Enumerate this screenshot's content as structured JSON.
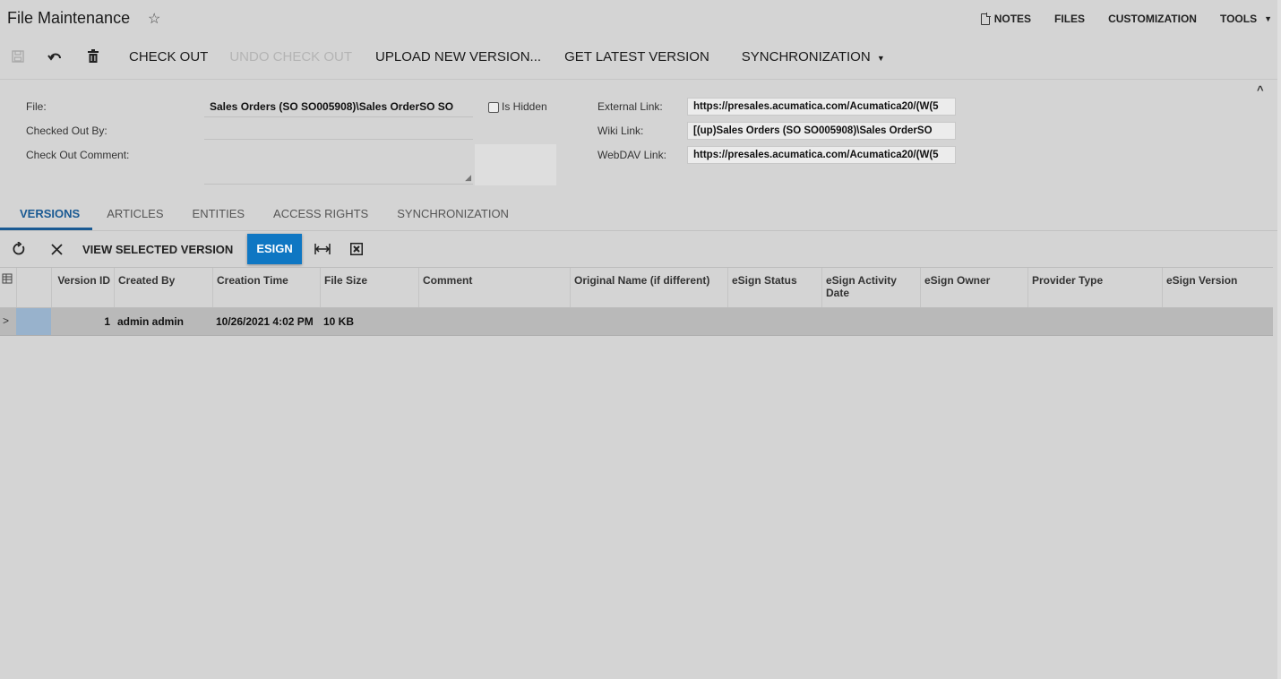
{
  "header": {
    "title": "File Maintenance",
    "star": "☆",
    "links": {
      "notes": "NOTES",
      "files": "FILES",
      "customization": "CUSTOMIZATION",
      "tools": "TOOLS"
    }
  },
  "toolbar": {
    "check_out": "CHECK OUT",
    "undo_check_out": "UNDO CHECK OUT",
    "upload_new_version": "UPLOAD NEW VERSION...",
    "get_latest_version": "GET LATEST VERSION",
    "synchronization": "SYNCHRONIZATION"
  },
  "form": {
    "file_label": "File:",
    "file_value": "Sales Orders (SO SO005908)\\Sales OrderSO SO",
    "is_hidden_label": "Is Hidden",
    "checked_out_by_label": "Checked Out By:",
    "check_out_comment_label": "Check Out Comment:",
    "external_link_label": "External Link:",
    "external_link_value": "https://presales.acumatica.com/Acumatica20/(W(5",
    "wiki_link_label": "Wiki Link:",
    "wiki_link_value": "[(up)Sales Orders (SO SO005908)\\Sales OrderSO",
    "webdav_link_label": "WebDAV Link:",
    "webdav_link_value": "https://presales.acumatica.com/Acumatica20/(W(5"
  },
  "tabs": [
    "VERSIONS",
    "ARTICLES",
    "ENTITIES",
    "ACCESS RIGHTS",
    "SYNCHRONIZATION"
  ],
  "grid_toolbar": {
    "view_selected_version": "VIEW SELECTED VERSION",
    "esign": "ESIGN"
  },
  "grid": {
    "columns": [
      "Version ID",
      "Created By",
      "Creation Time",
      "File Size",
      "Comment",
      "Original Name (if different)",
      "eSign Status",
      "eSign Activity Date",
      "eSign Owner",
      "Provider Type",
      "eSign Version"
    ],
    "rows": [
      {
        "expander": ">",
        "version_id": "1",
        "created_by": "admin admin",
        "creation_time": "10/26/2021 4:02 PM",
        "file_size": "10 KB",
        "comment": "",
        "original_name": "",
        "esign_status": "",
        "esign_activity_date": "",
        "esign_owner": "",
        "provider_type": "",
        "esign_version": ""
      }
    ]
  },
  "colors": {
    "accent": "#0f77c3",
    "tab_active": "#1a5a93",
    "background": "#d4d4d4",
    "selected_row": "#b9b9b9"
  }
}
